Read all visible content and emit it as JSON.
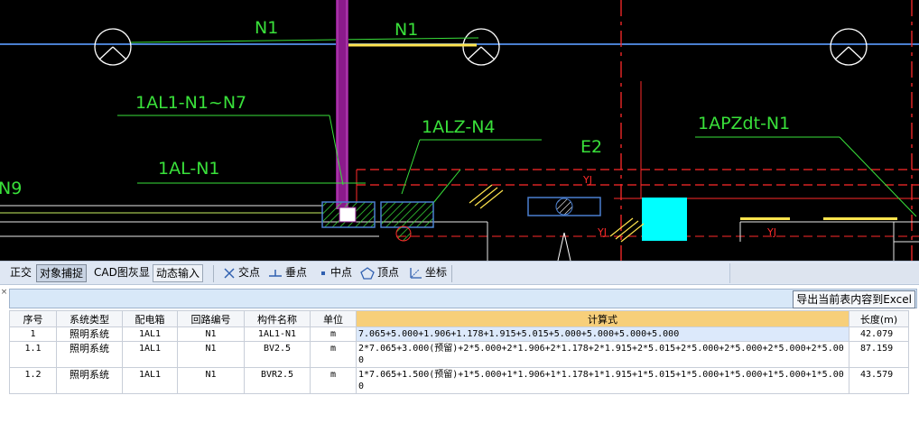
{
  "drawing": {
    "labels": {
      "n1_left": "N1",
      "n1_right": "N1",
      "circuit_1al1": "1AL1-N1~N7",
      "circuit_1alz": "1ALZ-N4",
      "circuit_1al": "1AL-N1",
      "circuit_1apzdt": "1APZdt-N1",
      "e2": "E2",
      "n9": "N9",
      "yj_1": "YJ",
      "yj_2": "YJ",
      "yj_3": "YJ"
    },
    "colors": {
      "background": "#000000",
      "annotation": "#39e03a",
      "wall": "#ff2a2a",
      "riser": "#8b1a8b",
      "equipment": "#00ffff",
      "conduit": "#ffe44d"
    }
  },
  "toolbar": {
    "ortho": "正交",
    "object_snap": "对象捕捉",
    "cad_gray": "CAD图灰显",
    "dynamic_input": "动态输入",
    "snap_intersection": "交点",
    "snap_perpendicular": "垂点",
    "snap_midpoint": "中点",
    "snap_vertex": "顶点",
    "snap_coordinate": "坐标"
  },
  "panel": {
    "close_glyph": "×",
    "export_label": "导出当前表内容到Excel"
  },
  "table": {
    "headers": {
      "index": "序号",
      "system_type": "系统类型",
      "panel_box": "配电箱",
      "circuit_no": "回路编号",
      "component": "构件名称",
      "unit": "单位",
      "formula": "计算式",
      "length": "长度(m)"
    },
    "rows": [
      {
        "index": "1",
        "system_type": "照明系统",
        "panel_box": "1AL1",
        "circuit_no": "N1",
        "component": "1AL1-N1",
        "unit": "m",
        "formula": "7.065+5.000+1.906+1.178+1.915+5.015+5.000+5.000+5.000+5.000",
        "length": "42.079"
      },
      {
        "index": "1.1",
        "system_type": "照明系统",
        "panel_box": "1AL1",
        "circuit_no": "N1",
        "component": "BV2.5",
        "unit": "m",
        "formula": "2*7.065+3.000(预留)+2*5.000+2*1.906+2*1.178+2*1.915+2*5.015+2*5.000+2*5.000+2*5.000+2*5.000",
        "length": "87.159"
      },
      {
        "index": "1.2",
        "system_type": "照明系统",
        "panel_box": "1AL1",
        "circuit_no": "N1",
        "component": "BVR2.5",
        "unit": "m",
        "formula": "1*7.065+1.500(预留)+1*5.000+1*1.906+1*1.178+1*1.915+1*5.015+1*5.000+1*5.000+1*5.000+1*5.000",
        "length": "43.579"
      }
    ]
  }
}
